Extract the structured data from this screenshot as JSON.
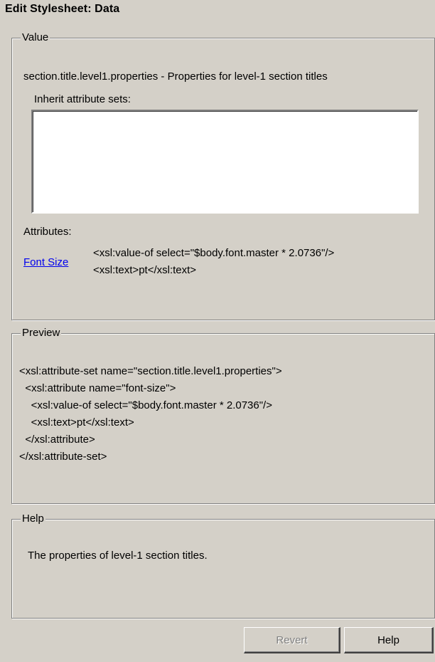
{
  "window": {
    "title": "Edit Stylesheet: Data"
  },
  "value_group": {
    "legend": "Value",
    "description": "section.title.level1.properties - Properties for level-1 section titles",
    "inherit_label": "Inherit attribute sets:",
    "inherit_items": [],
    "attributes_label": "Attributes:",
    "attributes": [
      {
        "name": "Font Size",
        "value_lines": [
          "<xsl:value-of select=\"$body.font.master * 2.0736\"/>",
          "<xsl:text>pt</xsl:text>"
        ]
      }
    ]
  },
  "preview_group": {
    "legend": "Preview",
    "lines": [
      "<xsl:attribute-set name=\"section.title.level1.properties\">",
      "  <xsl:attribute name=\"font-size\">",
      "    <xsl:value-of select=\"$body.font.master * 2.0736\"/>",
      "    <xsl:text>pt</xsl:text>",
      "  </xsl:attribute>",
      "</xsl:attribute-set>"
    ]
  },
  "help_group": {
    "legend": "Help",
    "text": "The properties of level-1 section titles."
  },
  "buttons": {
    "revert": {
      "label": "Revert",
      "enabled": false
    },
    "help": {
      "label": "Help",
      "enabled": true
    }
  }
}
